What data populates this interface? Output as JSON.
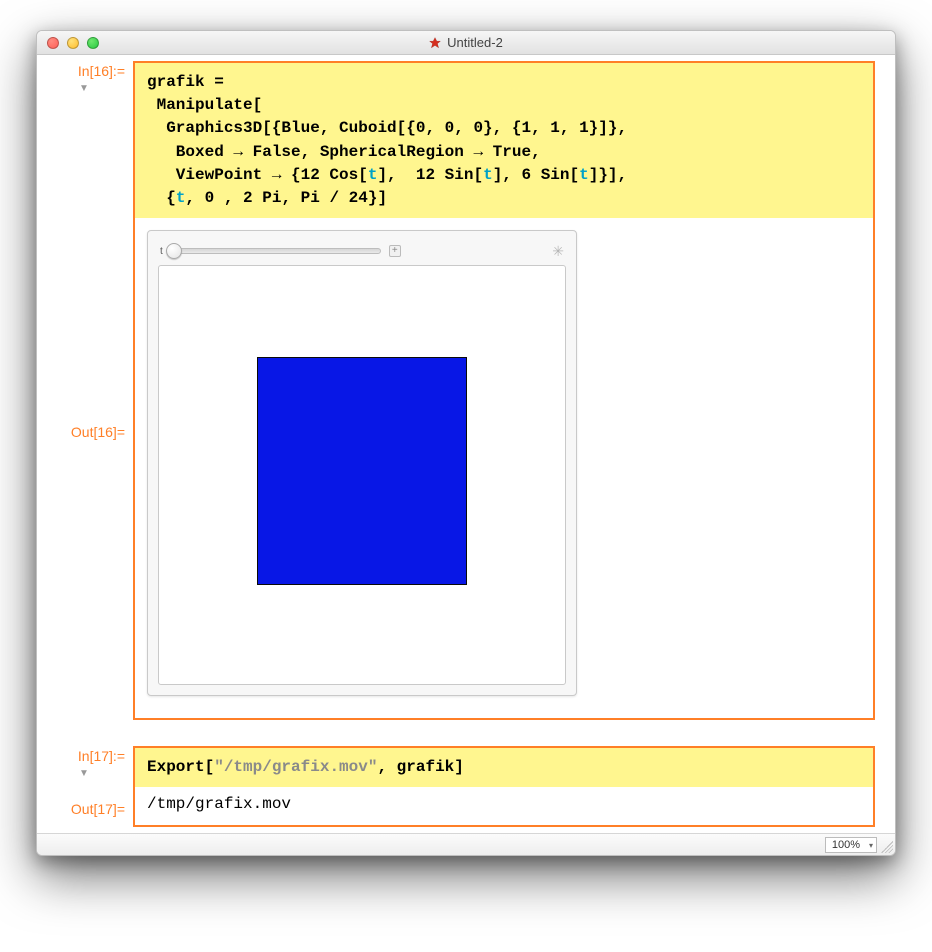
{
  "window": {
    "title": "Untitled-2"
  },
  "cells": {
    "group1": {
      "in_label": "In[16]:=",
      "out_label": "Out[16]=",
      "input": {
        "line1": "grafik =",
        "line2": " Manipulate[",
        "line3a": "  Graphics3D[{Blue, Cuboid[{0, 0, 0}, {1, 1, 1}]},",
        "line4a": "   Boxed → False, SphericalRegion → True,",
        "line5a": "   ViewPoint → {12 Cos[",
        "line5b": "t",
        "line5c": "],  12 Sin[",
        "line5d": "t",
        "line5e": "], 6 Sin[",
        "line5f": "t",
        "line5g": "]}],",
        "line6a": "  {",
        "line6b": "t",
        "line6c": ", 0 , 2 Pi, Pi / 24}]"
      },
      "manipulate": {
        "varlabel": "t",
        "plus": "+"
      }
    },
    "group2": {
      "in_label": "In[17]:=",
      "out_label": "Out[17]=",
      "input": {
        "pre": "Export[",
        "str": "\"/tmp/grafix.mov\"",
        "post": ", grafik]"
      },
      "output": "/tmp/grafix.mov"
    }
  },
  "statusbar": {
    "zoom": "100%"
  }
}
